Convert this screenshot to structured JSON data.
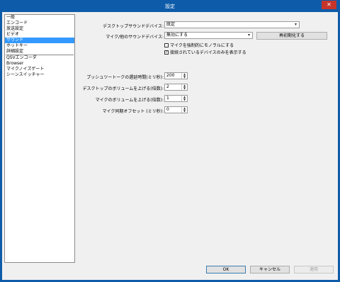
{
  "window": {
    "title": "設定",
    "close": "✕"
  },
  "sidebar": {
    "items": [
      "一般",
      "エンコード",
      "放送設定",
      "ビデオ",
      "サウンド",
      "ホットキー",
      "詳細設定",
      "QSVエンコーダ",
      "Browser",
      "マイクノイズゲート",
      "シーンスイッチャー"
    ],
    "selected": "サウンド"
  },
  "sound": {
    "desktop_device_label": "デスクトップサウンドデバイス:",
    "desktop_device_value": "既定",
    "mic_device_label": "マイク/他のサウンドデバイス:",
    "mic_device_value": "無効にする",
    "reset_button": "再初期化する",
    "force_mono_label": "マイクを強制的にモノラルにする",
    "force_mono_checked": false,
    "connected_only_label": "接続されているデバイスのみを表示する",
    "connected_only_checked": true,
    "ptt_delay_label": "プッシュツートークの遅延時間(ミリ秒):",
    "ptt_delay_value": "200",
    "desktop_boost_label": "デスクトップのボリュームを上げる(倍数):",
    "desktop_boost_value": "2",
    "mic_boost_label": "マイクのボリュームを上げる(倍数):",
    "mic_boost_value": "1",
    "mic_offset_label": "マイク同期オフセット (ミリ秒):",
    "mic_offset_value": "0"
  },
  "footer": {
    "ok": "OK",
    "cancel": "キャンセル",
    "apply": "適用"
  },
  "glyphs": {
    "dropdown": "▾",
    "check": "✓",
    "spin_up": "▲",
    "spin_down": "▼"
  }
}
